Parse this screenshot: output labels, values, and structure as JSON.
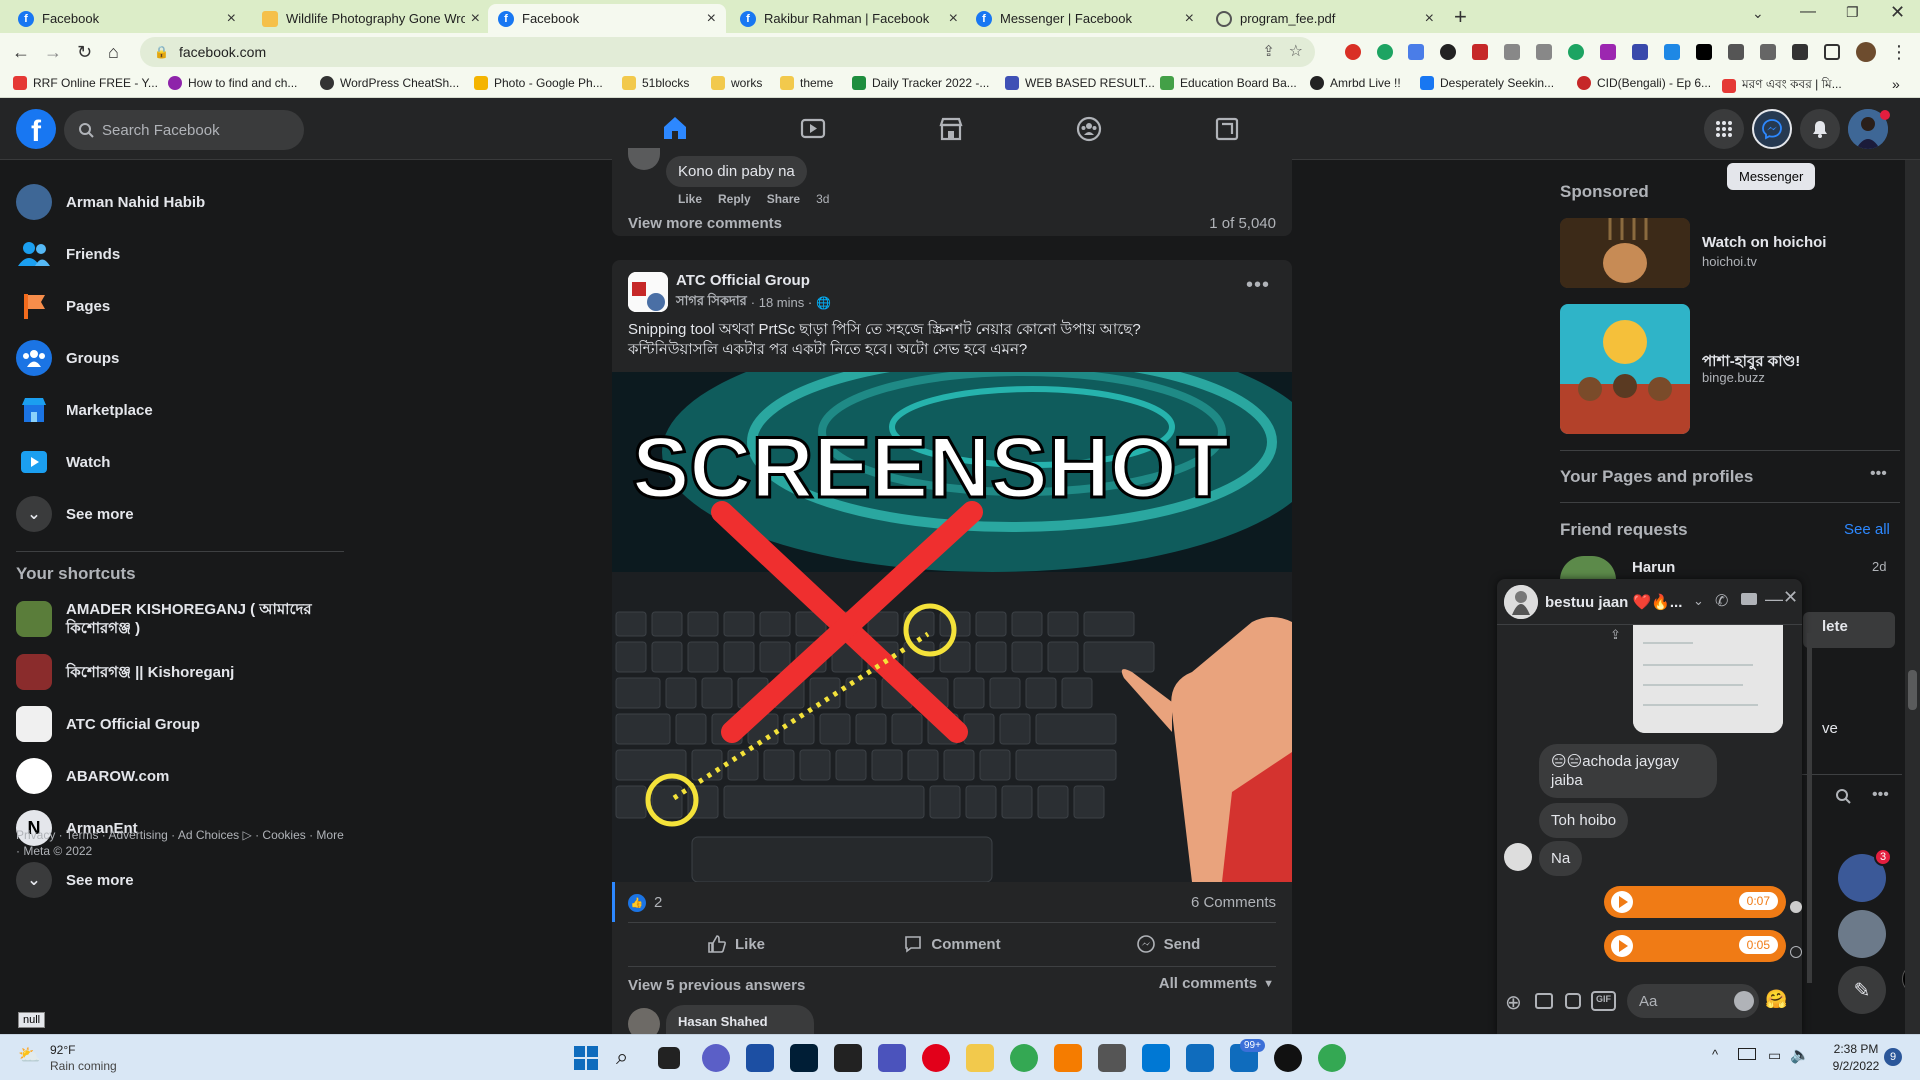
{
  "browser": {
    "tabs": [
      {
        "title": "Facebook",
        "active": false
      },
      {
        "title": "Wildlife Photography Gone Wron",
        "active": false
      },
      {
        "title": "Facebook",
        "active": true
      },
      {
        "title": "Rakibur Rahman | Facebook",
        "active": false
      },
      {
        "title": "Messenger | Facebook",
        "active": false
      },
      {
        "title": "program_fee.pdf",
        "active": false
      }
    ],
    "url": "facebook.com",
    "bookmarks": [
      "RRF Online FREE - Y...",
      "How to find and ch...",
      "WordPress CheatSh...",
      "Photo - Google Ph...",
      "51blocks",
      "works",
      "theme",
      "Daily Tracker 2022 -...",
      "WEB BASED RESULT...",
      "Education Board Ba...",
      "Amrbd Live !!",
      "Desperately Seekin...",
      "CID(Bengali) - Ep 6...",
      "মরণ এবং কবর | মি..."
    ]
  },
  "header": {
    "search_placeholder": "Search Facebook",
    "tooltip": "Messenger",
    "accent": "#1877f2"
  },
  "leftnav": {
    "items": [
      {
        "label": "Arman Nahid Habib",
        "icon": "avatar"
      },
      {
        "label": "Friends",
        "icon": "friends-icon"
      },
      {
        "label": "Pages",
        "icon": "pages-icon"
      },
      {
        "label": "Groups",
        "icon": "groups-icon"
      },
      {
        "label": "Marketplace",
        "icon": "marketplace-icon"
      },
      {
        "label": "Watch",
        "icon": "watch-icon"
      },
      {
        "label": "See more",
        "icon": "chevron-down-icon"
      }
    ],
    "shortcuts_title": "Your shortcuts",
    "shortcuts": [
      {
        "label": "AMADER KISHOREGANJ ( আমাদের কিশোরগঞ্জ )"
      },
      {
        "label": "কিশোরগঞ্জ || Kishoreganj"
      },
      {
        "label": "ATC Official Group"
      },
      {
        "label": "ABAROW.com"
      },
      {
        "label": "ArmanEnt"
      },
      {
        "label": "See more"
      }
    ],
    "footer": "Privacy · Terms · Advertising · Ad Choices ▷ · Cookies · More · Meta © 2022",
    "null_badge": "null"
  },
  "feed": {
    "prev_comment": {
      "text": "Kono din paby na",
      "actions": [
        "Like",
        "Reply",
        "Share"
      ],
      "time": "3d",
      "view_more": "View more comments",
      "count": "1 of 5,040"
    },
    "post": {
      "group": "ATC Official Group",
      "author": "সাগর সিকদার",
      "time": "· 18 mins ·",
      "text_line1": "Snipping tool অথবা PrtSc ছাড়া পিসি তে সহজে স্ক্রিনশট নেয়ার কোনো উপায় আছে?",
      "text_line2": "কন্টিনিউয়াসলি একটার পর একটা নিতে হবে। অটো সেভ হবে এমন?",
      "image_headline": "SCREENSHOT",
      "reaction_count": "2",
      "comments_count": "6 Comments",
      "actions": {
        "like": "Like",
        "comment": "Comment",
        "send": "Send"
      },
      "view_previous": "View 5 previous answers",
      "sort": "All comments",
      "next_commenter": "Hasan Shahed"
    }
  },
  "right": {
    "sponsored_title": "Sponsored",
    "ads": [
      {
        "title": "Watch on hoichoi",
        "domain": "hoichoi.tv"
      },
      {
        "title": "পাশা-হাবুর কাণ্ড!",
        "domain": "binge.buzz"
      }
    ],
    "pages_title": "Your Pages and profiles",
    "friend_requests_title": "Friend requests",
    "see_all": "See all",
    "request_name": "Harun",
    "request_time": "2d",
    "delete_partial": "lete",
    "partial_text": "ve",
    "contact_badge": "3"
  },
  "chat": {
    "name": "bestuu jaan ❤️🔥...",
    "messages": [
      {
        "text": "😑😑achoda jaygay jaiba",
        "side": "in"
      },
      {
        "text": "Toh hoibo",
        "side": "in"
      },
      {
        "text": "Na",
        "side": "in"
      }
    ],
    "audio": [
      {
        "duration": "0:07"
      },
      {
        "duration": "0:05"
      }
    ],
    "input_placeholder": "Aa",
    "gif_label": "GIF"
  },
  "taskbar": {
    "temp": "92°F",
    "weather": "Rain coming",
    "badge": "99+",
    "time": "2:38 PM",
    "date": "9/2/2022",
    "notif": "9"
  }
}
